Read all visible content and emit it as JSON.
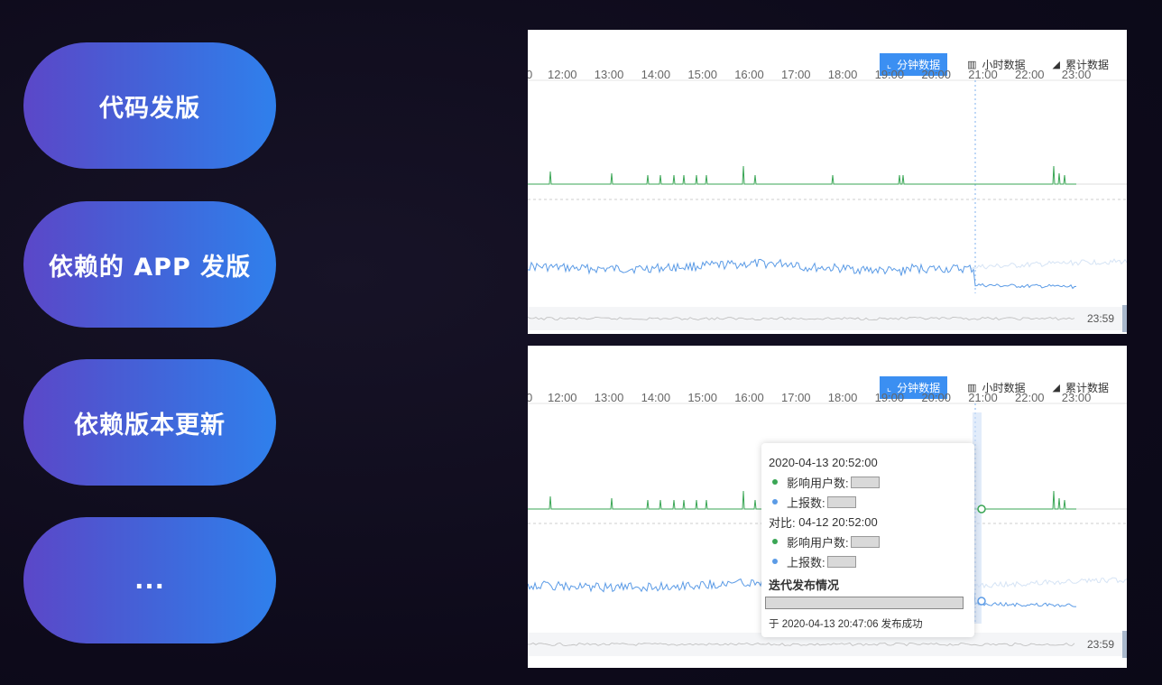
{
  "pills": [
    {
      "label": "代码发版"
    },
    {
      "label": "依赖的 APP 发版"
    },
    {
      "label": "依赖版本更新"
    },
    {
      "label": "..."
    }
  ],
  "panel_top": {
    "tabs": {
      "minute": "分钟数据",
      "hour": "小时数据",
      "cumulative": "累计数据"
    },
    "time_labels": [
      "12:00",
      "13:00",
      "14:00",
      "15:00",
      "16:00",
      "17:00",
      "18:00",
      "19:00",
      "20:00",
      "21:00",
      "22:00",
      "23:00"
    ],
    "end_label": "23:59"
  },
  "panel_bottom": {
    "tabs": {
      "minute": "分钟数据",
      "hour": "小时数据",
      "cumulative": "累计数据"
    },
    "time_labels": [
      "12:00",
      "13:00",
      "14:00",
      "15:00",
      "16:00",
      "17:00",
      "18:00",
      "19:00",
      "20:00",
      "21:00",
      "22:00",
      "23:00"
    ],
    "end_label": "23:59",
    "tooltip": {
      "timestamp": "2020-04-13 20:52:00",
      "affected_users_label": "影响用户数:",
      "reports_label": "上报数:",
      "compare_label": "对比:",
      "compare_time": "04-12 20:52:00",
      "compare_affected_label": "影响用户数:",
      "compare_reports_label": "上报数:",
      "release_title": "迭代发布情况",
      "release_footer": "于 2020-04-13 20:47:06 发布成功"
    }
  },
  "colors": {
    "green": "#3aa655",
    "blue": "#5b9be6",
    "accent": "#3b8ff2"
  },
  "icons": {
    "minute": "line-chart-icon",
    "hour": "bar-chart-icon",
    "cumulative": "area-chart-icon"
  }
}
